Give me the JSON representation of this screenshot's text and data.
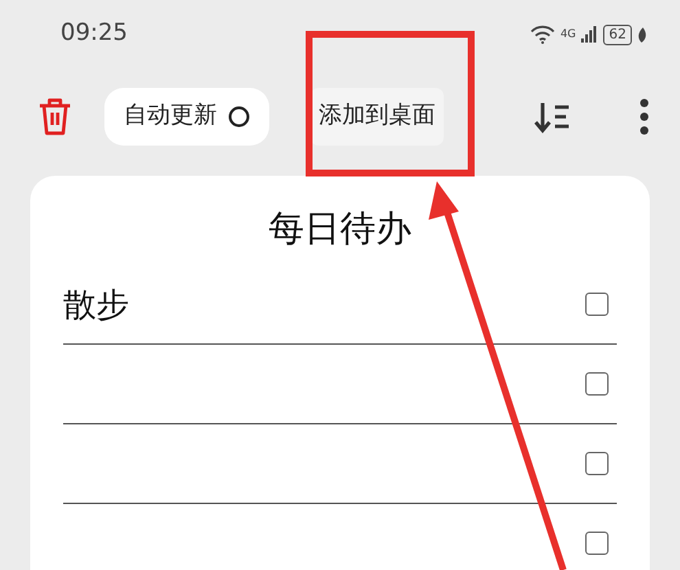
{
  "status_bar": {
    "time": "09:25",
    "network": "4G",
    "battery": "62"
  },
  "toolbar": {
    "auto_update": {
      "label": "自动更新",
      "on": false
    },
    "add_to_desktop": {
      "label": "添加到桌面"
    }
  },
  "card": {
    "title": "每日待办",
    "items": [
      {
        "text": "散步",
        "checked": false
      },
      {
        "checked": false
      },
      {
        "checked": false
      },
      {
        "checked": false
      }
    ]
  }
}
